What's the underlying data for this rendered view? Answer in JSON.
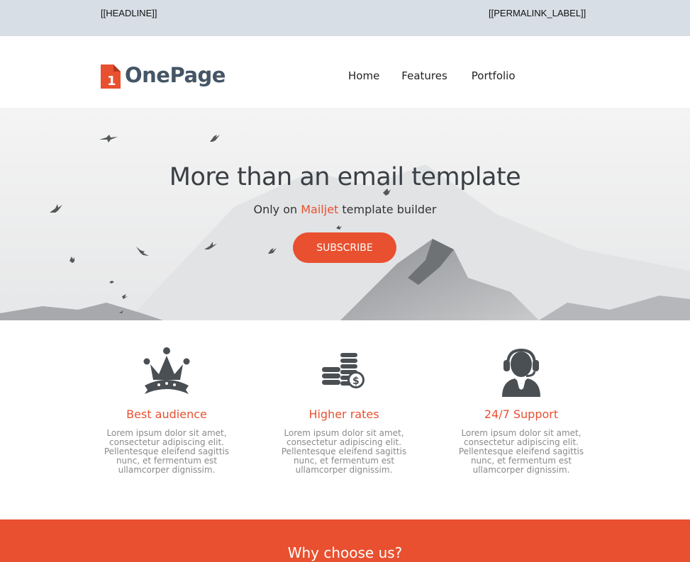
{
  "preheader": {
    "headline": "[[HEADLINE]]",
    "permalink": "[[PERMALINK_LABEL]]"
  },
  "header": {
    "logo_digit": "1",
    "logo_text": "OnePage",
    "nav": [
      {
        "label": "Home"
      },
      {
        "label": "Features"
      },
      {
        "label": "Portfolio"
      }
    ]
  },
  "hero": {
    "title": "More than an email template",
    "subtitle_before": "Only on ",
    "subtitle_brand": "Mailjet",
    "subtitle_after": " template builder",
    "button_label": "SUBSCRIBE"
  },
  "features": [
    {
      "icon": "crown-icon",
      "title": "Best audience",
      "text": "Lorem ipsum dolor sit amet, consectetur adipiscing elit. Pellentesque eleifend sagittis nunc, et fermentum est ullamcorper dignissim."
    },
    {
      "icon": "coins-icon",
      "title": "Higher rates",
      "text": "Lorem ipsum dolor sit amet, consectetur adipiscing elit. Pellentesque eleifend sagittis nunc, et fermentum est ullamcorper dignissim."
    },
    {
      "icon": "headset-support-icon",
      "title": "24/7 Support",
      "text": "Lorem ipsum dolor sit amet, consectetur adipiscing elit. Pellentesque eleifend sagittis nunc, et fermentum est ullamcorper dignissim."
    }
  ],
  "why": {
    "title": "Why choose us?"
  },
  "colors": {
    "accent": "#e8502f",
    "preheader_bg": "#d8dee6",
    "logo_text": "#445566",
    "icon": "#4a4f54"
  }
}
